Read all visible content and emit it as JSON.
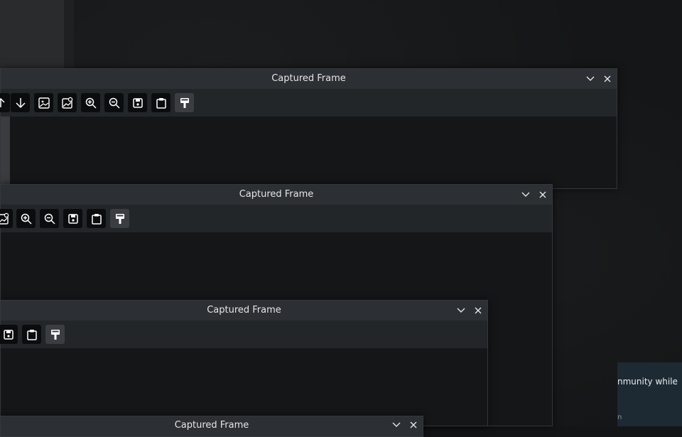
{
  "notification": {
    "text": "nmunity while",
    "subtext": "n"
  },
  "frames": [
    {
      "title": "Captured Frame"
    },
    {
      "title": "Captured Frame"
    },
    {
      "title": "Captured Frame"
    },
    {
      "title": "Captured Frame"
    }
  ],
  "icons": {
    "minimize": "chevron-down-icon",
    "close": "close-icon",
    "tools": [
      "arrow-down-icon",
      "image-icon",
      "image-export-icon",
      "zoom-in-icon",
      "zoom-out-icon",
      "save-icon",
      "clipboard-icon",
      "paint-icon"
    ]
  }
}
